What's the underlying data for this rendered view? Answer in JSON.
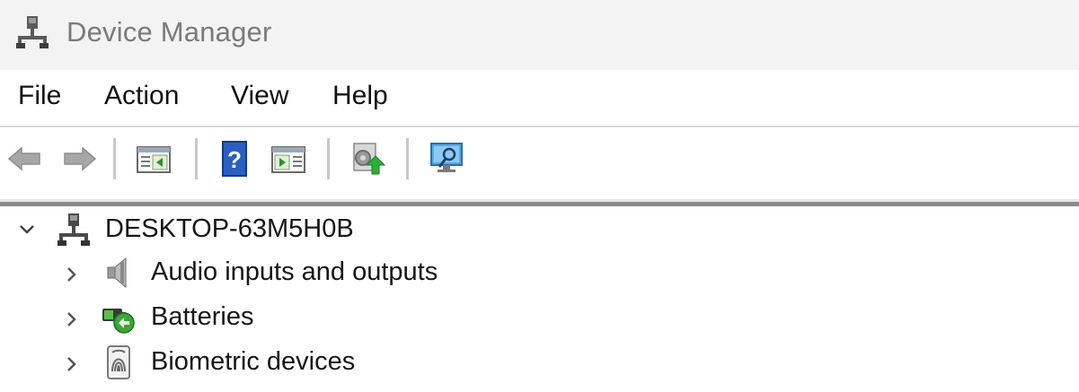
{
  "window": {
    "title": "Device Manager",
    "title_icon": "computer-network-icon"
  },
  "menu": {
    "items": [
      {
        "label": "File"
      },
      {
        "label": "Action"
      },
      {
        "label": "View"
      },
      {
        "label": "Help"
      }
    ]
  },
  "toolbar": {
    "buttons": [
      {
        "icon": "back-arrow-icon"
      },
      {
        "icon": "forward-arrow-icon"
      },
      {
        "icon": "show-hide-console-tree-icon"
      },
      {
        "icon": "help-icon"
      },
      {
        "icon": "show-hide-action-pane-icon"
      },
      {
        "icon": "update-driver-icon"
      },
      {
        "icon": "scan-hardware-changes-icon"
      }
    ]
  },
  "tree": {
    "root": {
      "label": "DESKTOP-63M5H0B",
      "expanded": true,
      "icon": "computer-network-icon"
    },
    "children": [
      {
        "label": "Audio inputs and outputs",
        "icon": "speaker-icon",
        "expanded": false
      },
      {
        "label": "Batteries",
        "icon": "battery-icon",
        "expanded": false
      },
      {
        "label": "Biometric devices",
        "icon": "fingerprint-icon",
        "expanded": false
      }
    ]
  },
  "colors": {
    "title_bar_bg": "#f3f3f3",
    "title_text": "#7a7a7a",
    "accent_blue": "#2c5fc0"
  }
}
